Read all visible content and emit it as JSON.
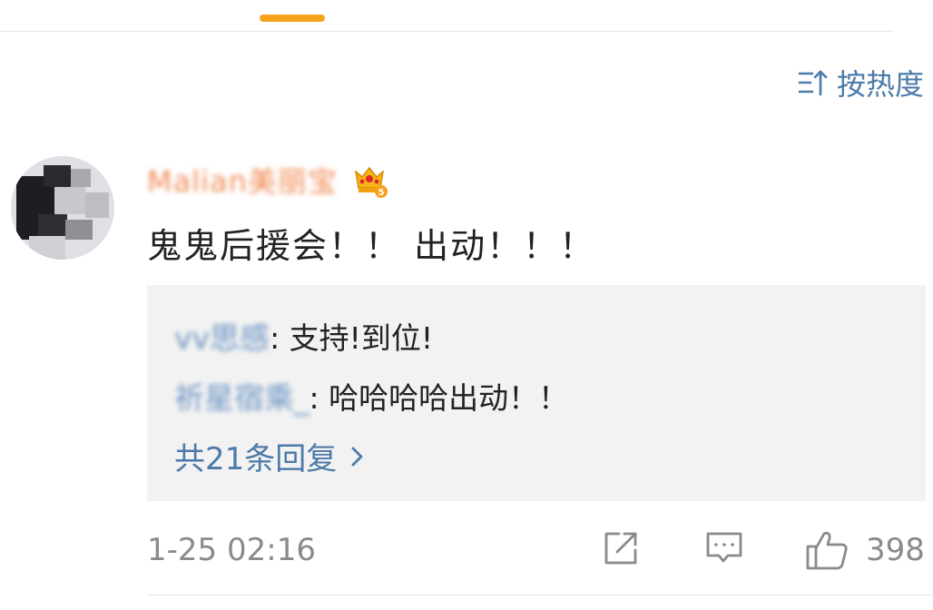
{
  "sort": {
    "label": "按热度"
  },
  "comment": {
    "username": "Malian美丽宝",
    "text": "鬼鬼后援会！！ 出动！！！",
    "timestamp": "1-25 02:16",
    "like_count": "398"
  },
  "replies": [
    {
      "name": "vv思感",
      "text": ": 支持!到位!"
    },
    {
      "name": "祈星宿乘_",
      "text": ": 哈哈哈哈出动！！"
    }
  ],
  "reply_more": {
    "label": "共21条回复"
  },
  "colors": {
    "accent": "#f7a21b",
    "link": "#4c7aa8",
    "username": "#f08a55",
    "muted": "#8a8a8a"
  },
  "icons": [
    "sort-icon",
    "crown-badge-icon",
    "chevron-right-icon",
    "repost-icon",
    "comment-icon",
    "like-icon"
  ]
}
